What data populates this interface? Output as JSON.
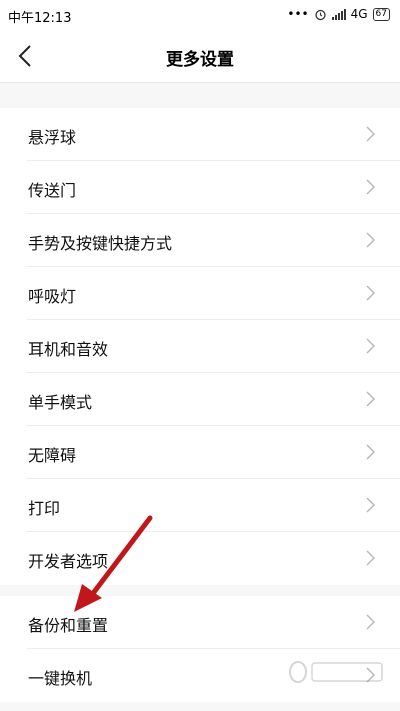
{
  "status_bar": {
    "time": "中午12:13",
    "signal_text": "4G",
    "battery": "67"
  },
  "header": {
    "title": "更多设置"
  },
  "group1": [
    {
      "label": "悬浮球"
    },
    {
      "label": "传送门"
    },
    {
      "label": "手势及按键快捷方式"
    },
    {
      "label": "呼吸灯"
    },
    {
      "label": "耳机和音效"
    },
    {
      "label": "单手模式"
    },
    {
      "label": "无障碍"
    },
    {
      "label": "打印"
    },
    {
      "label": "开发者选项"
    }
  ],
  "group2": [
    {
      "label": "备份和重置"
    },
    {
      "label": "一键换机"
    }
  ],
  "colors": {
    "annotation_arrow": "#c0171b",
    "chevron": "#b5b5b5"
  },
  "icons": {
    "back": "chevron-left-icon",
    "row": "chevron-right-icon"
  }
}
